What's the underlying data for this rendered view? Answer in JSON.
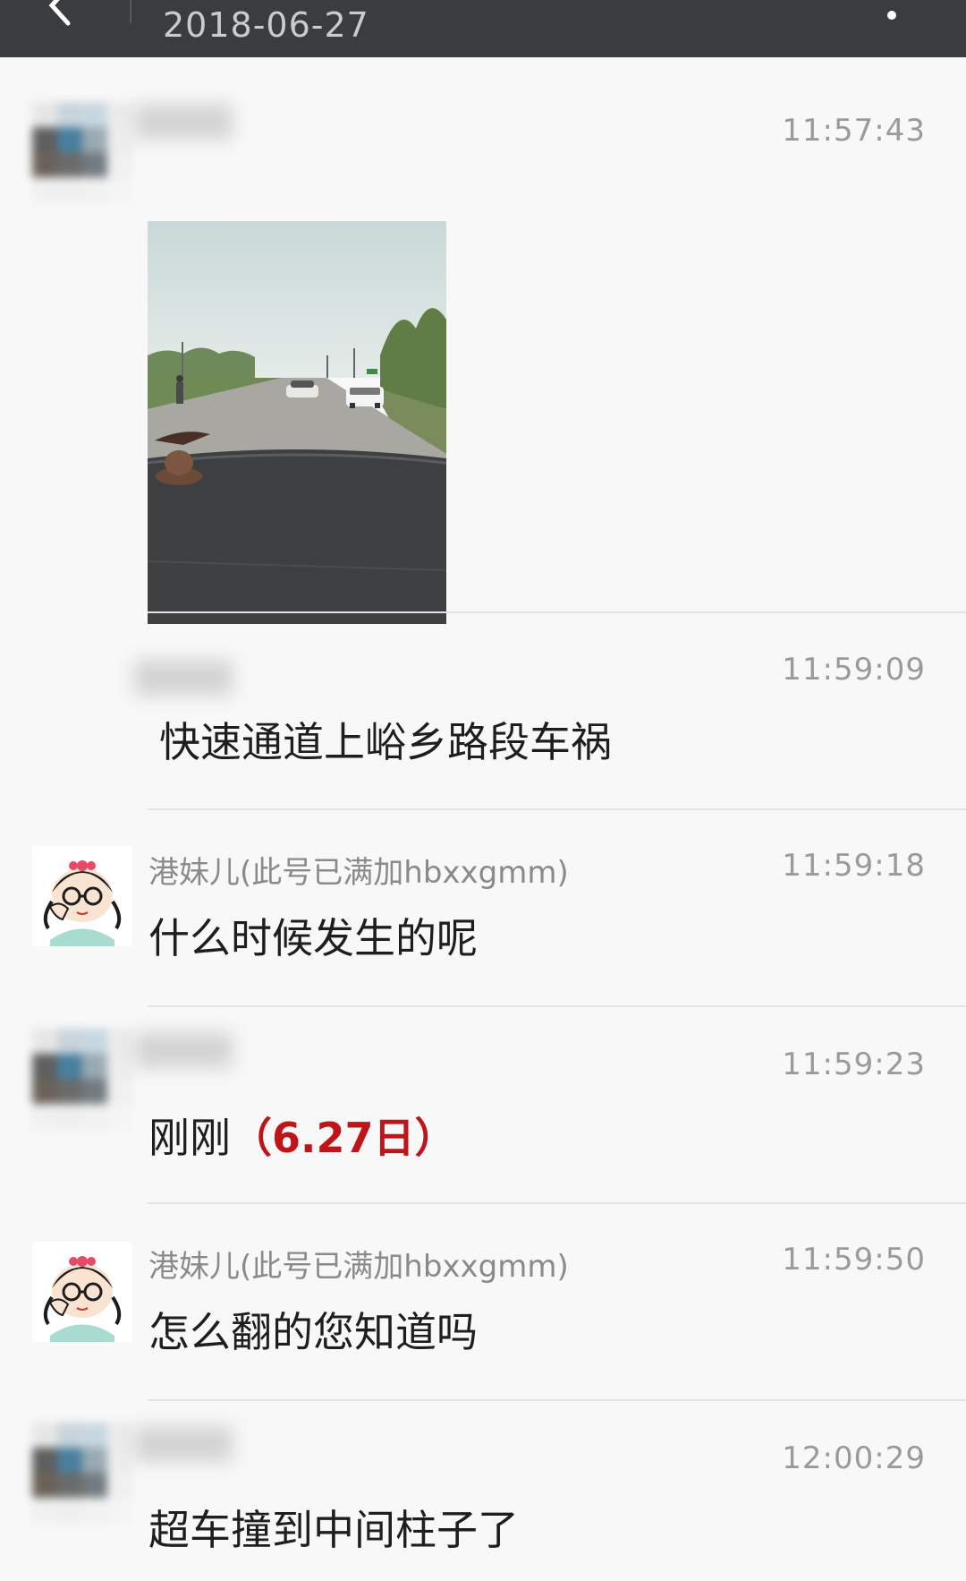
{
  "topbar": {
    "date": "2018-06-27",
    "back_icon": "back-arrow-icon",
    "more_icon": "more-dot-icon"
  },
  "messages": [
    {
      "sender": "",
      "time": "11:57:43",
      "type": "image",
      "avatar": "pixelated-avatar"
    },
    {
      "sender": "",
      "time": "11:59:09",
      "text": "快速通道上峪乡路段车祸"
    },
    {
      "sender": "港妹儿(此号已满加hbxxgmm)",
      "time": "11:59:18",
      "text": "什么时候发生的呢",
      "avatar": "cartoon-girl-avatar"
    },
    {
      "sender": "",
      "time": "11:59:23",
      "text": "刚刚",
      "highlight": "（6.27日）",
      "highlight_color": "#c0141b",
      "avatar": "pixelated-avatar"
    },
    {
      "sender": "港妹儿(此号已满加hbxxgmm)",
      "time": "11:59:50",
      "text": "怎么翻的您知道吗",
      "avatar": "cartoon-girl-avatar"
    },
    {
      "sender": "",
      "time": "12:00:29",
      "text": "超车撞到中间柱子了",
      "avatar": "pixelated-avatar"
    }
  ]
}
